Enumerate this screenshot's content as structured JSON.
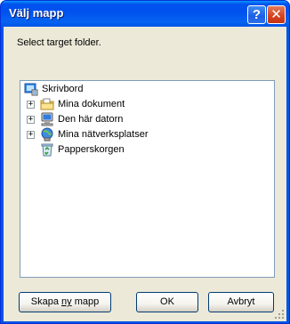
{
  "window": {
    "title": "Välj mapp",
    "help_glyph": "?",
    "close_glyph": "✕"
  },
  "prompt": "Select target folder.",
  "tree": {
    "root": {
      "label": "Skrivbord",
      "icon": "desktop-icon"
    },
    "children": [
      {
        "label": "Mina dokument",
        "icon": "documents-folder-icon",
        "expandable": true
      },
      {
        "label": "Den här datorn",
        "icon": "computer-icon",
        "expandable": true
      },
      {
        "label": "Mina nätverksplatser",
        "icon": "network-places-icon",
        "expandable": true
      },
      {
        "label": "Papperskorgen",
        "icon": "recycle-bin-icon",
        "expandable": false
      }
    ],
    "expander_glyph": "+"
  },
  "buttons": {
    "new_folder_pre": "Skapa ",
    "new_folder_underlined": "ny",
    "new_folder_post": " mapp",
    "ok": "OK",
    "cancel": "Avbryt"
  }
}
